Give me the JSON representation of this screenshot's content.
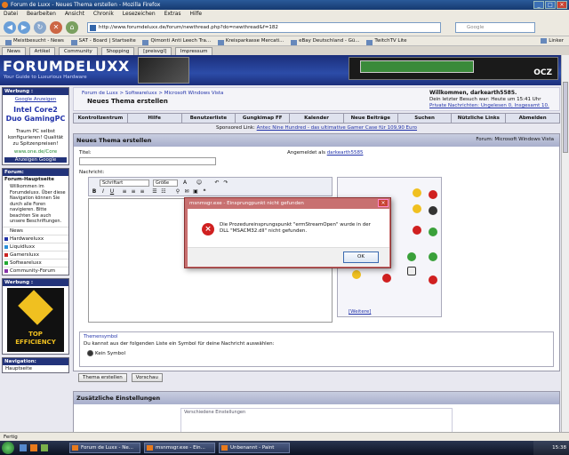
{
  "window": {
    "title": "Forum de Luxx - Neues Thema erstellen - Mozilla Firefox"
  },
  "menu": [
    "Datei",
    "Bearbeiten",
    "Ansicht",
    "Chronik",
    "Lesezeichen",
    "Extras",
    "Hilfe"
  ],
  "address": {
    "url": "http://www.forumdeluxx.de/forum/newthread.php?do=newthread&f=182",
    "search_placeholder": "Google"
  },
  "bookmarks": [
    "Meistbesucht - News",
    "SAT - Board | Startseite",
    "Qimonti Anti Leech Tra...",
    "Kreisparkasse Mercati...",
    "eBay Deutschland - Gü...",
    "TwitchTV Lite",
    "Linker"
  ],
  "tabs": [
    "News",
    "Artikel",
    "Community",
    "Shopping",
    "[preisvgl]",
    "Impressum"
  ],
  "header": {
    "logo": "FORUMDELUXX",
    "logo_sub": "Your Guide to Luxurious Hardware",
    "ad_brand": "OCZ"
  },
  "sidebar": {
    "ad1_title": "Werbung :",
    "ad1_link": "Google Anzeigen",
    "ad1_big": "Intel Core2 Duo GamingPC",
    "ad1_text": "Traum PC selbst konfigurieren! Qualität zu Spitzenpreisen!",
    "ad1_url": "www.one.de/Core",
    "ad1_bottom": "Anzeigen Google",
    "forum_title": "Forum:",
    "forum_home": "Forum-Hauptseite",
    "forum_text": "Willkommen im Forumdeluxx. Über diese Navigation können Sie durch alle Foren navigieren. Bitte beachten Sie auch unsere Beschriftungen.",
    "items": [
      {
        "label": "News",
        "color": "#ffffff"
      },
      {
        "label": "Hardwareluxx",
        "color": "#2233aa"
      },
      {
        "label": "Liquidluxx",
        "color": "#2a8fd8"
      },
      {
        "label": "Gamersluxx",
        "color": "#cc2222"
      },
      {
        "label": "Softwareluxx",
        "color": "#22aa33"
      },
      {
        "label": "Community-Forum",
        "color": "#8833aa"
      }
    ],
    "ad2_title": "Werbung :",
    "ad2_badge1": "TOP",
    "ad2_badge2": "EFFICIENCY",
    "nav_title": "Navigation:",
    "nav_home": "Hauptseite"
  },
  "main": {
    "crumb": "Forum de Luxx > Softwareluxx > Microsoft Windows Vista",
    "page_title": "Neues Thema erstellen",
    "welcome_title": "Willkommen, darkearth5585.",
    "welcome_l1": "Dein letzter Besuch war: Heute um 15:41 Uhr",
    "welcome_l2": "Private Nachrichten: Ungelesen 0, Insgesamt 10.",
    "navtabs": [
      "Kontrollzentrum",
      "Hilfe",
      "Benutzerliste",
      "Gungkimap FF",
      "Kalender",
      "Neue Beiträge",
      "Suchen",
      "Nützliche Links",
      "Abmelden"
    ],
    "sponsored_label": "Sponsored Link:",
    "sponsored_text": "Antec Nine Hundred - das ultimative Gamer Case für 109,90 Euro",
    "box_title": "Neues Thema erstellen",
    "forum_label": "Forum: Microsoft Windows Vista",
    "title_label": "Titel:",
    "loggedin_label": "Angemeldet als",
    "loggedin_user": "darkearth5585",
    "message_label": "Nachricht:",
    "font_select": "Schriftart",
    "size_select": "Größe",
    "toolbar": [
      "B",
      "I",
      "U"
    ],
    "more_smilies": "[Weitere]",
    "icon_legend": "Themensymbol",
    "icon_text": "Du kannst aus der folgenden Liste ein Symbol für deine Nachricht auswählen:",
    "no_icon": "Kein Symbol",
    "submit_btn": "Thema erstellen",
    "preview_btn": "Vorschau",
    "extra_title": "Zusätzliche Einstellungen",
    "extra_inner": "Verschiedene Einstellungen"
  },
  "dialog": {
    "title": "msnmsgr.exe - Einsprungpunkt nicht gefunden",
    "message": "Die Prozedureinsprungspunkt \"ermStreamOpen\" wurde in der DLL \"MSACM32.dll\" nicht gefunden.",
    "ok": "OK"
  },
  "status": "Fertig",
  "taskbar": {
    "tasks": [
      "Forum de Luxx - Ne...",
      "msnmsgr.exe - Ein...",
      "Unbenannt - Paint"
    ],
    "clock": "15:38"
  }
}
